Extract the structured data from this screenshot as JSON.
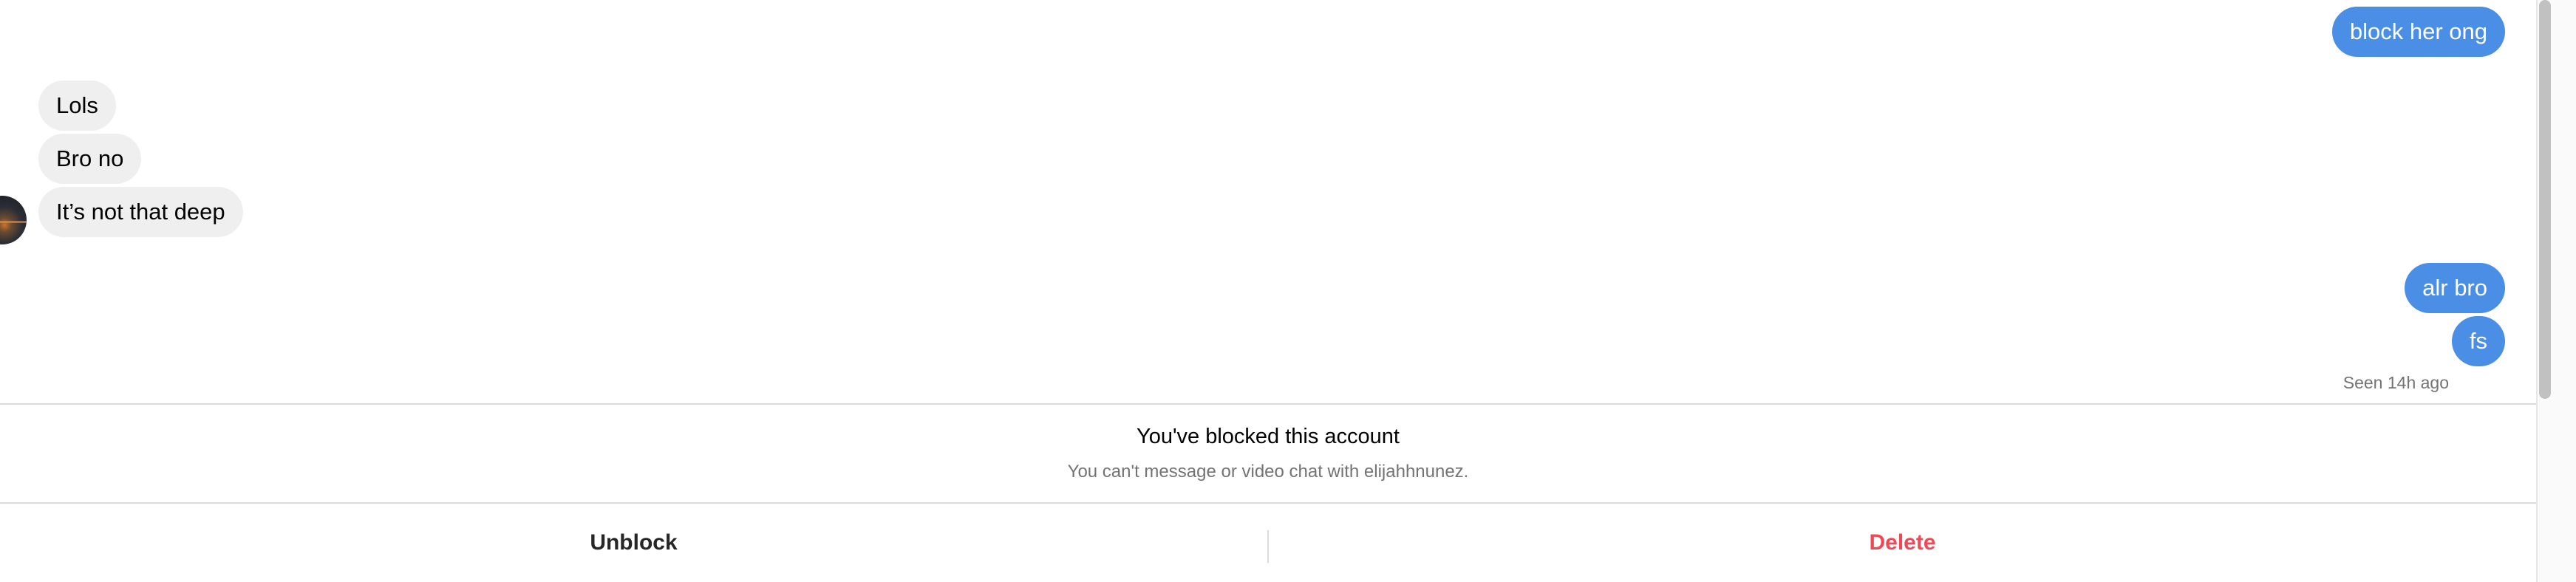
{
  "messages": {
    "out_1": "block her ong",
    "in_1": "Lols",
    "in_2": "Bro no",
    "in_3": "It’s not that deep",
    "out_2": "alr bro",
    "out_3": "fs"
  },
  "seen_status": "Seen 14h ago",
  "blocked_notice": {
    "title": "You've blocked this account",
    "subtitle": "You can't message or video chat with elijahhnunez."
  },
  "actions": {
    "unblock_label": "Unblock",
    "delete_label": "Delete"
  },
  "colors": {
    "outgoing_bubble": "#4a8ee6",
    "incoming_bubble": "#efefef",
    "delete_text": "#ed4956"
  },
  "icons": {
    "avatar": "contact-avatar"
  }
}
